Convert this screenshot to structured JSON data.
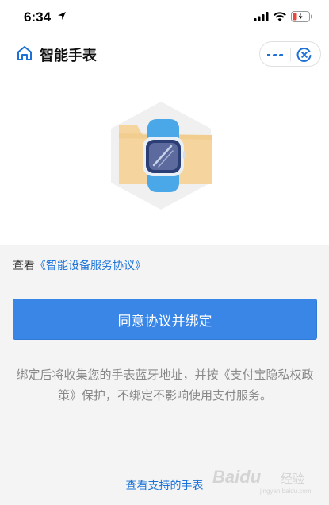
{
  "status_bar": {
    "time": "6:34"
  },
  "nav": {
    "title": "智能手表"
  },
  "agreement": {
    "prefix": "查看",
    "link": "《智能设备服务协议》"
  },
  "primary_button": {
    "label": "同意协议并绑定"
  },
  "notice": {
    "text": "绑定后将收集您的手表蓝牙地址，并按《支付宝隐私权政策》保护，不绑定不影响使用支付服务。"
  },
  "bottom_link": {
    "label": "查看支持的手表"
  },
  "watermark": {
    "brand": "Bai",
    "brand_suffix": "du",
    "sub": "经验",
    "url": "jingyan.baidu.com"
  },
  "colors": {
    "accent": "#3a86e6",
    "link": "#1a73d9",
    "watch_band": "#4aa8e8",
    "folder": "#f5d49d"
  }
}
